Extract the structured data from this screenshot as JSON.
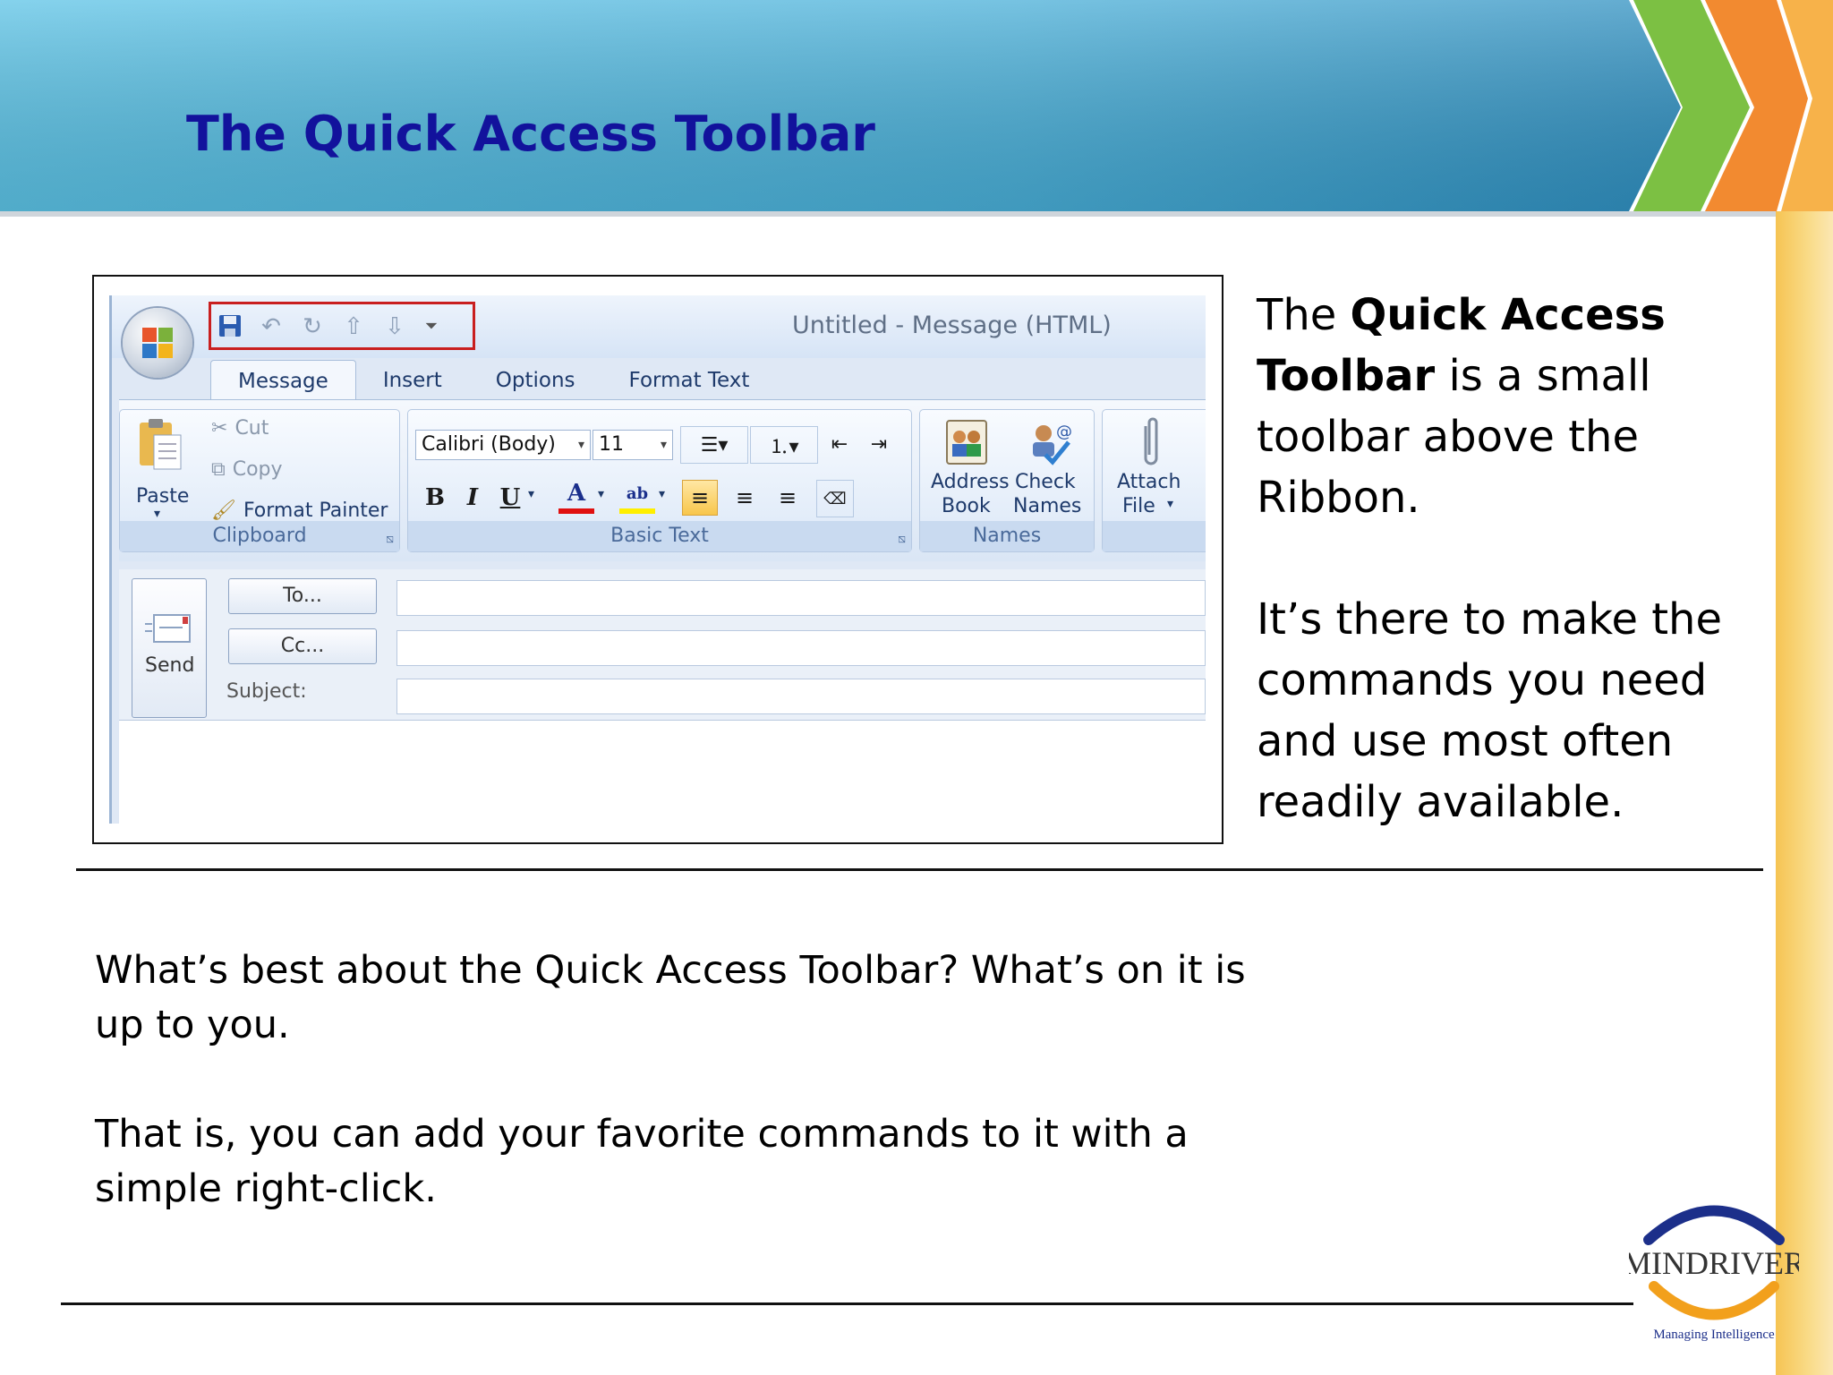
{
  "slide": {
    "title": "The Quick Access Toolbar"
  },
  "outlook": {
    "window_title": "Untitled - Message (HTML)",
    "tabs": [
      "Message",
      "Insert",
      "Options",
      "Format Text"
    ],
    "clipboard": {
      "paste_label": "Paste",
      "cut_label": "Cut",
      "copy_label": "Copy",
      "format_painter_label": "Format Painter",
      "group_label": "Clipboard"
    },
    "basic_text": {
      "font_name": "Calibri (Body)",
      "font_size": "11",
      "bold": "B",
      "italic": "I",
      "underline": "U",
      "font_color_glyph": "A",
      "highlight_glyph": "ab",
      "group_label": "Basic Text"
    },
    "names": {
      "address_book_line1": "Address",
      "address_book_line2": "Book",
      "check_names_line1": "Check",
      "check_names_line2": "Names",
      "group_label": "Names"
    },
    "include": {
      "attach_line1": "Attach",
      "attach_line2": "File"
    },
    "compose": {
      "send_label": "Send",
      "to_label": "To...",
      "cc_label": "Cc...",
      "subject_label": "Subject:"
    }
  },
  "side_text": {
    "p1_prefix": "The ",
    "p1_bold": "Quick Access Toolbar",
    "p1_suffix": " is a small toolbar above the Ribbon.",
    "p2": "It’s there to make the commands you need and use most often readily available."
  },
  "bottom_text": {
    "p1": "What’s best about the Quick Access Toolbar? What’s on it is up to you.",
    "p2": "That is, you can add your favorite commands to it with a simple right-click."
  },
  "logo": {
    "name": "MindRiver",
    "tagline": "Managing Intelligence"
  },
  "colors": {
    "title": "#12129c",
    "banner": "#4fb5dc",
    "qat_highlight": "#c91f1f",
    "accent_green": "#7cc043",
    "accent_orange": "#f28a30"
  }
}
